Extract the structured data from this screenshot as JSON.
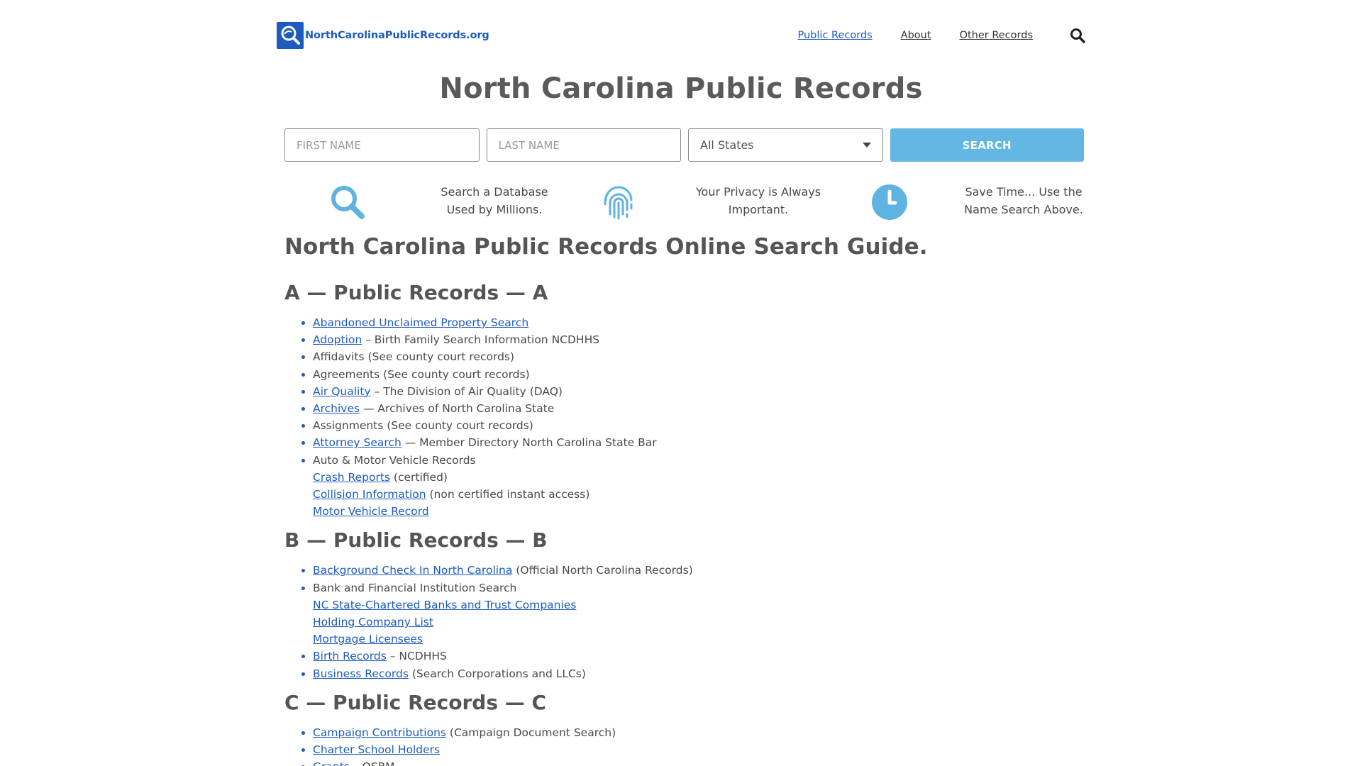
{
  "header": {
    "logo_text": "NorthCarolinaPublicRecords.org",
    "nav": [
      {
        "label": "Public Records",
        "active": true
      },
      {
        "label": "About",
        "active": false
      },
      {
        "label": "Other Records",
        "active": false
      }
    ]
  },
  "page_title": "North Carolina Public Records",
  "search": {
    "first_name_placeholder": "FIRST NAME",
    "last_name_placeholder": "LAST NAME",
    "state_value": "All States",
    "button_label": "SEARCH"
  },
  "features": [
    {
      "icon": "search-icon",
      "line1": "Search a Database",
      "line2": "Used by Millions."
    },
    {
      "icon": "fingerprint-icon",
      "line1": "Your Privacy is Always",
      "line2": "Important."
    },
    {
      "icon": "clock-icon",
      "line1": "Save Time... Use the",
      "line2": "Name Search Above."
    }
  ],
  "guide_title": "North Carolina Public Records Online Search Guide.",
  "sections": [
    {
      "title": "A — Public Records — A",
      "items": [
        {
          "link": "Abandoned Unclaimed Property Search",
          "text": ""
        },
        {
          "link": "Adoption",
          "text": " – Birth Family Search Information NCDHHS"
        },
        {
          "link": "",
          "text": "Affidavits (See county court records)"
        },
        {
          "link": "",
          "text": "Agreements (See county court records)"
        },
        {
          "link": "Air Quality",
          "text": " – The Division of Air Quality (DAQ)"
        },
        {
          "link": "Archives",
          "text": " — Archives of North Carolina State"
        },
        {
          "link": "",
          "text": "Assignments (See county court records)"
        },
        {
          "link": "Attorney Search",
          "text": " — Member Directory North Carolina State Bar"
        },
        {
          "link": "",
          "text": "Auto & Motor Vehicle Records"
        },
        {
          "link": "Crash Reports",
          "text": " (certified)",
          "sub": true
        },
        {
          "link": "Collision Information",
          "text": " (non certified instant access)",
          "sub": true
        },
        {
          "link": "Motor Vehicle Record",
          "text": "",
          "sub": true
        }
      ]
    },
    {
      "title": "B — Public Records — B",
      "items": [
        {
          "link": "Background Check In North Carolina",
          "text": " (Official North Carolina Records)"
        },
        {
          "link": "",
          "text": "Bank and Financial Institution Search"
        },
        {
          "link": "NC State-Chartered Banks and Trust Companies",
          "text": "",
          "sub": true
        },
        {
          "link": "Holding Company List",
          "text": "",
          "sub": true
        },
        {
          "link": "Mortgage Licensees",
          "text": "",
          "sub": true
        },
        {
          "link": "Birth Records",
          "text": " – NCDHHS"
        },
        {
          "link": "Business Records",
          "text": " (Search Corporations and LLCs)"
        }
      ]
    },
    {
      "title": "C — Public Records — C",
      "items": [
        {
          "link": "Campaign Contributions",
          "text": " (Campaign Document Search)"
        },
        {
          "link": "Charter School Holders",
          "text": ""
        },
        {
          "link": "Grants",
          "text": " – OSBM"
        }
      ]
    }
  ],
  "colors": {
    "link": "#1d5bbf",
    "accent": "#64b6e3",
    "heading": "#555555"
  }
}
